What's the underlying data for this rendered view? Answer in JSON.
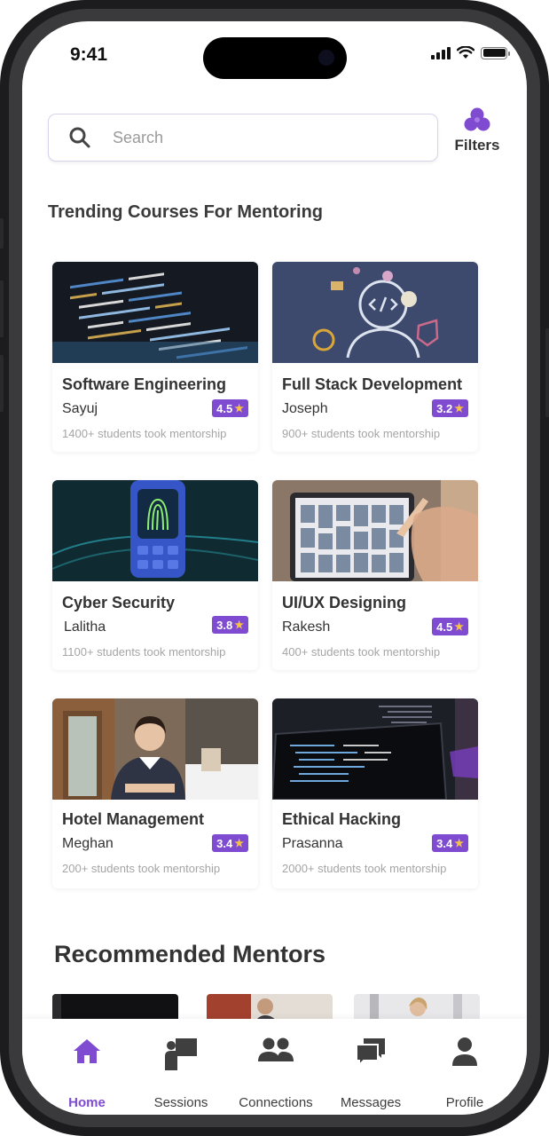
{
  "status_bar": {
    "time": "9:41"
  },
  "search": {
    "placeholder": "Search"
  },
  "filters": {
    "label": "Filters",
    "icon": "filters-icon"
  },
  "trending": {
    "title": "Trending Courses For Mentoring",
    "courses": [
      {
        "title": "Software Engineering",
        "mentor": "Sayuj",
        "rating": "4.5",
        "students": "1400+ students took mentorship",
        "image": "code-screen-image"
      },
      {
        "title": "Full Stack Development",
        "mentor": "Joseph",
        "rating": "3.2",
        "students": "900+ students took mentorship",
        "image": "developer-illustration-image"
      },
      {
        "title": "Cyber Security",
        "mentor": "Lalitha",
        "rating": "3.8",
        "students": "1100+ students took mentorship",
        "image": "fingerprint-image"
      },
      {
        "title": "UI/UX Designing",
        "mentor": "Rakesh",
        "rating": "4.5",
        "students": "400+ students took mentorship",
        "image": "tablet-design-image"
      },
      {
        "title": "Hotel Management",
        "mentor": "Meghan",
        "rating": "3.4",
        "students": "200+ students took mentorship",
        "image": "hotel-staff-image"
      },
      {
        "title": "Ethical Hacking",
        "mentor": "Prasanna",
        "rating": "3.4",
        "students": "2000+ students took mentorship",
        "image": "laptop-code-image"
      }
    ]
  },
  "recommended": {
    "title": "Recommended Mentors"
  },
  "tabbar": {
    "tabs": [
      {
        "label": "Home",
        "icon": "home-icon",
        "active": true
      },
      {
        "label": "Sessions",
        "icon": "sessions-icon",
        "active": false
      },
      {
        "label": "Connections",
        "icon": "connections-icon",
        "active": false
      },
      {
        "label": "Messages",
        "icon": "messages-icon",
        "active": false
      },
      {
        "label": "Profile",
        "icon": "profile-icon",
        "active": false
      }
    ]
  },
  "colors": {
    "accent": "#7f4bd0",
    "star": "#f6c343",
    "text": "#333333",
    "muted": "#a5a5a5"
  }
}
